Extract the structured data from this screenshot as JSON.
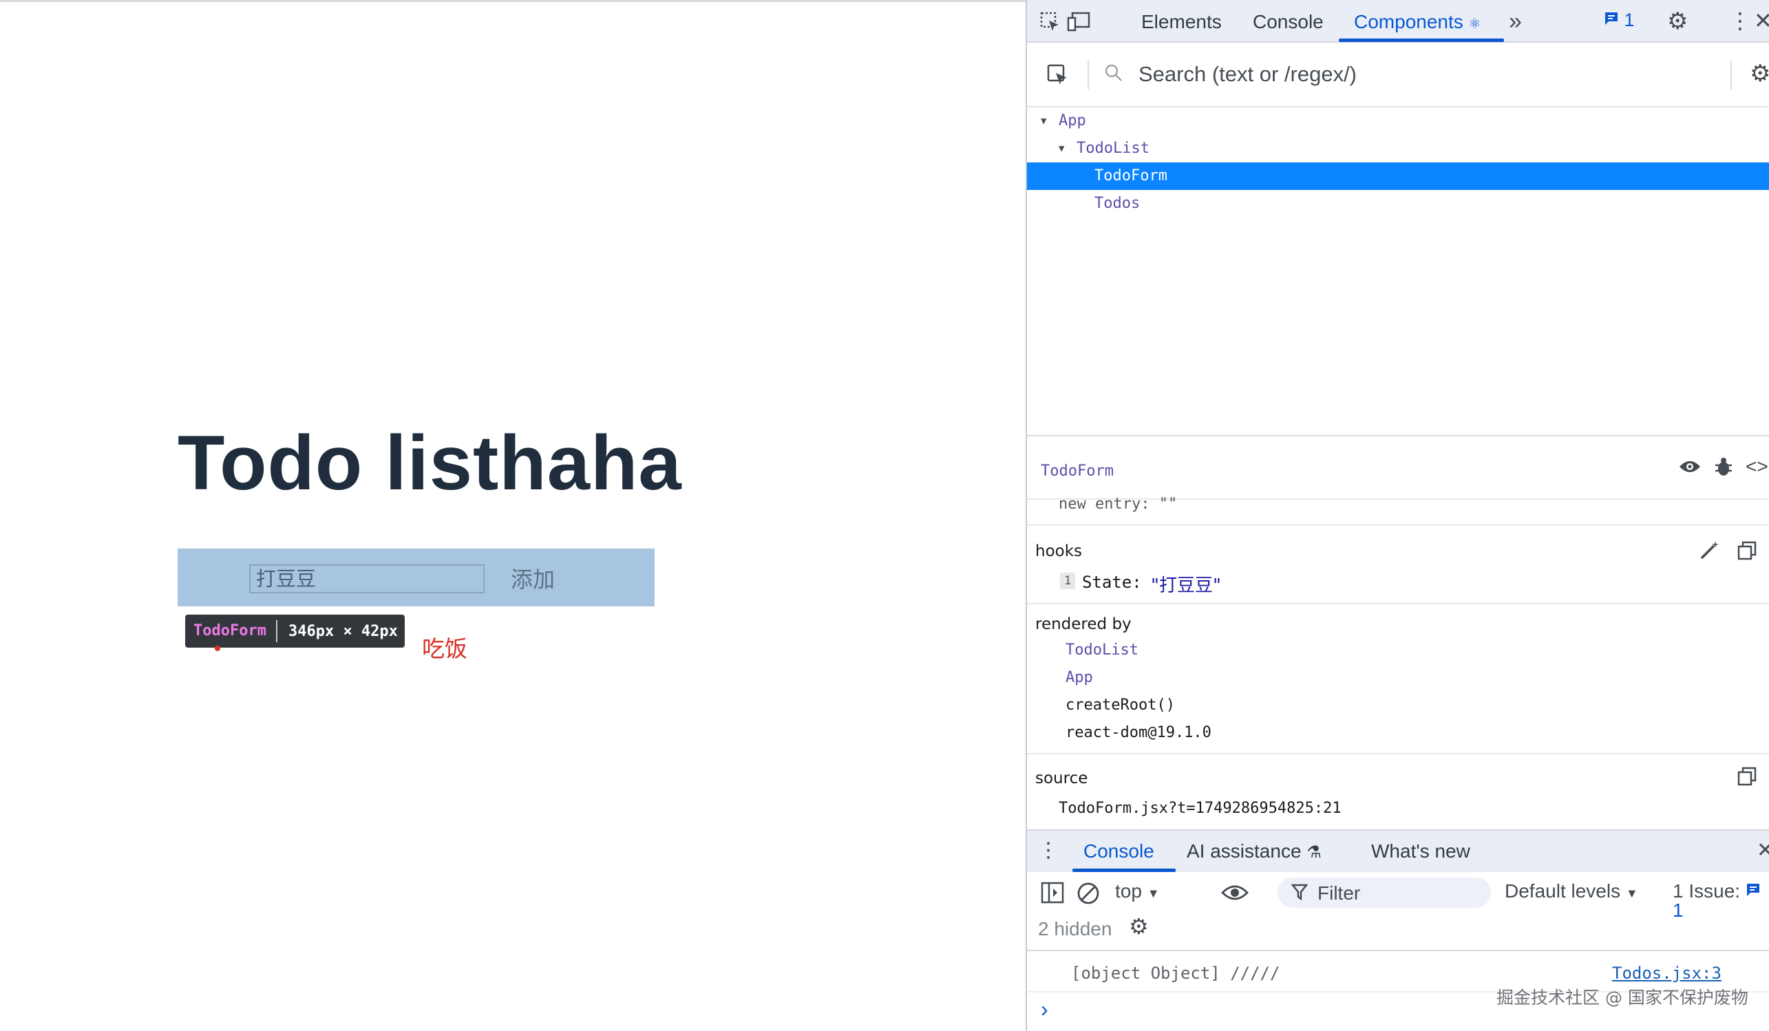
{
  "app": {
    "title": "Todo listhaha",
    "input_value": "打豆豆",
    "add_button": "添加",
    "inspect_tooltip": {
      "component": "TodoForm",
      "size": "346px × 42px"
    },
    "todo_items": [
      "吃饭"
    ]
  },
  "devtools": {
    "tabs": [
      "Elements",
      "Console",
      "Components"
    ],
    "active_tab": "Components",
    "issues_badge": "1",
    "search_placeholder": "Search (text or /regex/)",
    "tree": [
      {
        "label": "App",
        "expanded": true
      },
      {
        "label": "TodoList",
        "expanded": true
      },
      {
        "label": "TodoForm",
        "selected": true
      },
      {
        "label": "Todos"
      }
    ],
    "inspector": {
      "component_name": "TodoForm",
      "props_partial": "new entry: \"\"",
      "hooks_label": "hooks",
      "hook_index": "1",
      "hook_name": "State:",
      "hook_value": "\"打豆豆\"",
      "rendered_by_label": "rendered by",
      "rendered_by": [
        "TodoList",
        "App",
        "createRoot()",
        "react-dom@19.1.0"
      ],
      "source_label": "source",
      "source_value": "TodoForm.jsx?t=1749286954825:21"
    },
    "drawer": {
      "tabs": [
        "Console",
        "AI assistance",
        "What's new"
      ],
      "active_tab": "Console",
      "context": "top",
      "filter_placeholder": "Filter",
      "levels": "Default levels",
      "issues_label": "1 Issue:",
      "issues_count": "1",
      "hidden_count": "2 hidden",
      "messages": [
        {
          "text": "[object Object] /////",
          "source": "Todos.jsx:3"
        }
      ],
      "prompt": "›"
    },
    "watermark": "掘金技术社区 @ 国家不保护废物"
  },
  "colors": {
    "accent": "#0b57d0",
    "selection": "#0a84ff",
    "highlight": "#a7c4e0",
    "todo_red": "#d93025"
  }
}
